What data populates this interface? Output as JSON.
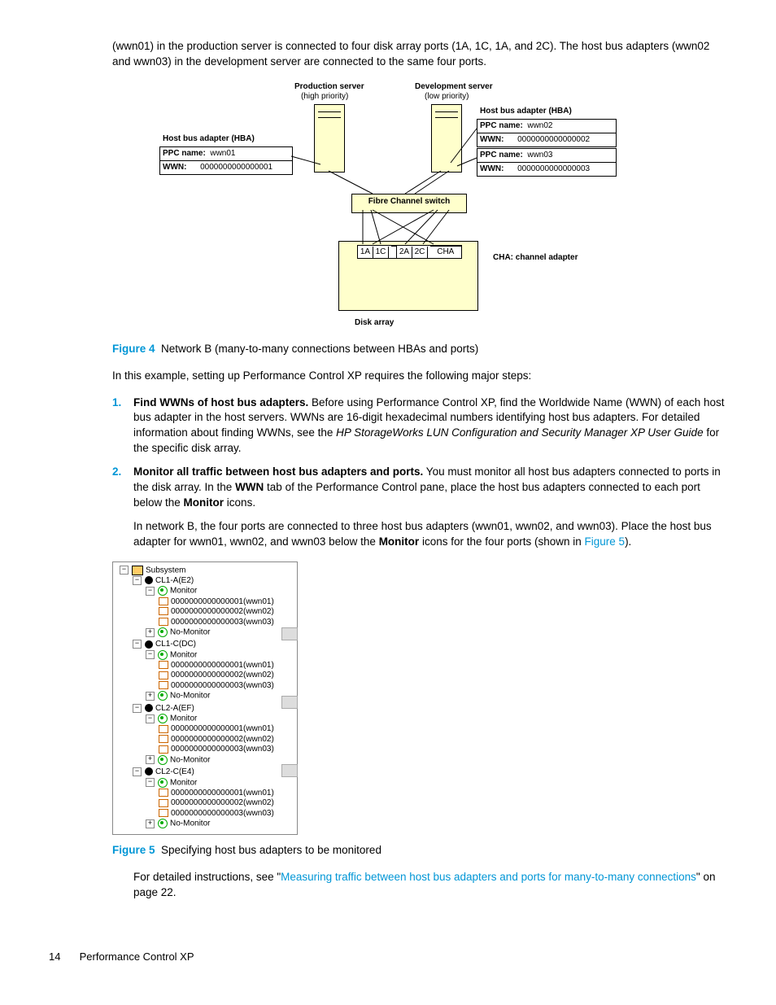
{
  "intro": "(wwn01) in the production server is connected to four disk array ports (1A, 1C, 1A, and 2C). The host bus adapters (wwn02 and wwn03) in the development server are connected to the same four ports.",
  "diagram": {
    "prod_server": "Production server",
    "prod_priority": "(high priority)",
    "dev_server": "Development server",
    "dev_priority": "(low priority)",
    "hba_label": "Host bus adapter (HBA)",
    "ppc_label": "PPC name:",
    "wwn_label": "WWN:",
    "hba1_ppc": "wwn01",
    "hba1_wwn": "0000000000000001",
    "hba2_ppc": "wwn02",
    "hba2_wwn": "0000000000000002",
    "hba3_ppc": "wwn03",
    "hba3_wwn": "0000000000000003",
    "fc_switch": "Fibre Channel switch",
    "slots": [
      "1A",
      "1C",
      "2A",
      "2C"
    ],
    "cha": "CHA",
    "cha_note": "CHA: channel adapter",
    "disk_array": "Disk array"
  },
  "fig4": {
    "label": "Figure 4",
    "caption": "Network B (many-to-many connections between HBAs and ports)"
  },
  "afterFig4": "In this example, setting up Performance Control XP requires the following major steps:",
  "step1": {
    "num": "1.",
    "lead": "Find WWNs of host bus adapters.",
    "body_a": " Before using Performance Control XP, find the Worldwide Name (WWN) of each host bus adapter in the host servers. WWNs are 16-digit hexadecimal numbers identifying host bus adapters. For detailed information about finding WWNs, see the ",
    "ital": "HP StorageWorks LUN Configuration and Security Manager XP User Guide",
    "body_b": " for the specific disk array."
  },
  "step2": {
    "num": "2.",
    "lead": "Monitor all traffic between host bus adapters and ports.",
    "body_a": " You must monitor all host bus adapters connected to ports in the disk array. In the ",
    "bold_wwn": "WWN",
    "body_b": " tab of the Performance Control pane, place the host bus adapters connected to each port below the ",
    "bold_mon": "Monitor",
    "body_c": " icons.",
    "para2_a": "In network B, the four ports are connected to three host bus adapters (wwn01, wwn02, and wwn03). Place the host bus adapter for wwn01, wwn02, and wwn03 below the ",
    "para2_b": " icons for the four ports (shown in ",
    "fig5link": "Figure 5",
    "para2_c": ")."
  },
  "tree": {
    "root": "Subsystem",
    "ports": [
      "CL1-A(E2)",
      "CL1-C(DC)",
      "CL2-A(EF)",
      "CL2-C(E4)"
    ],
    "monitor": "Monitor",
    "nomonitor": "No-Monitor",
    "items": [
      "0000000000000001(wwn01)",
      "0000000000000002(wwn02)",
      "0000000000000003(wwn03)"
    ]
  },
  "fig5": {
    "label": "Figure 5",
    "caption": "Specifying host bus adapters to be monitored"
  },
  "afterFig5_a": "For detailed instructions, see \"",
  "afterFig5_link": "Measuring traffic between host bus adapters and ports for many-to-many connections",
  "afterFig5_b": "\" on page 22.",
  "footer": {
    "page": "14",
    "title": "Performance Control XP"
  }
}
